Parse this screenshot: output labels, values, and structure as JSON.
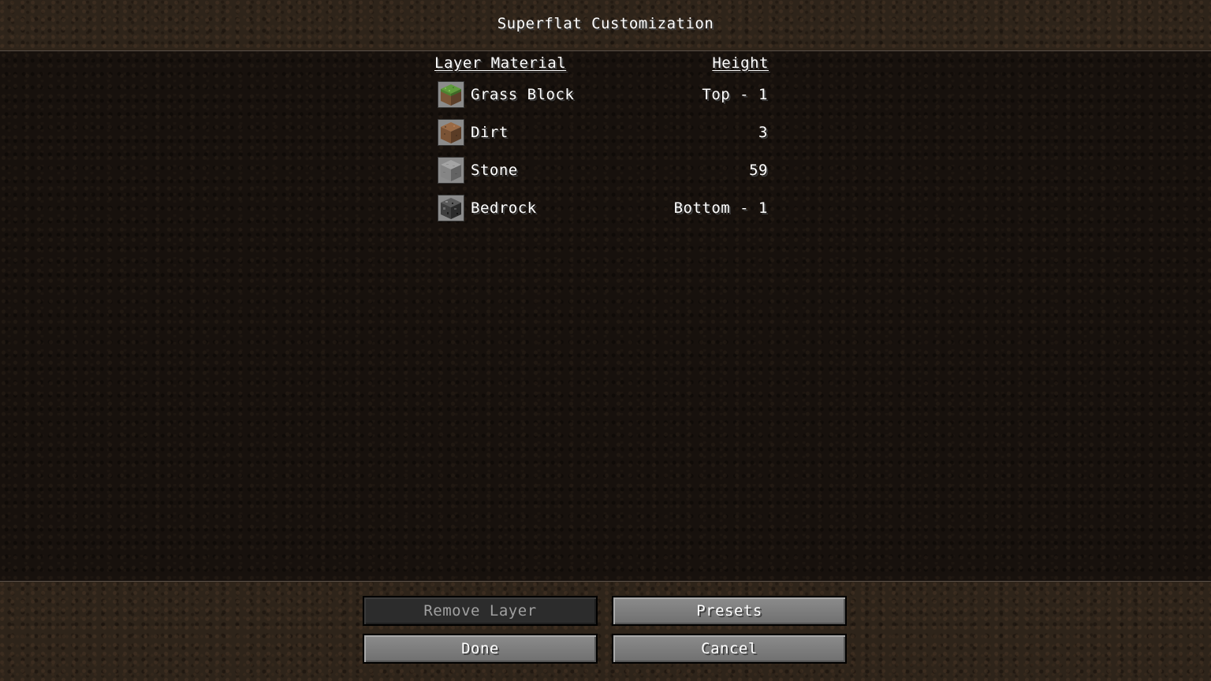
{
  "title": "Superflat Customization",
  "headers": {
    "material": "Layer Material",
    "height": "Height"
  },
  "layers": [
    {
      "name": "Grass Block",
      "height": "Top - 1",
      "icon": "grass-block-icon"
    },
    {
      "name": "Dirt",
      "height": "3",
      "icon": "dirt-icon"
    },
    {
      "name": "Stone",
      "height": "59",
      "icon": "stone-icon"
    },
    {
      "name": "Bedrock",
      "height": "Bottom - 1",
      "icon": "bedrock-icon"
    }
  ],
  "buttons": {
    "remove_layer": "Remove Layer",
    "presets": "Presets",
    "done": "Done",
    "cancel": "Cancel"
  },
  "colors": {
    "text": "#ffffff",
    "disabled_text": "#a0a0a0",
    "button": "#7a7a7a",
    "button_disabled": "#2c2c2c"
  }
}
